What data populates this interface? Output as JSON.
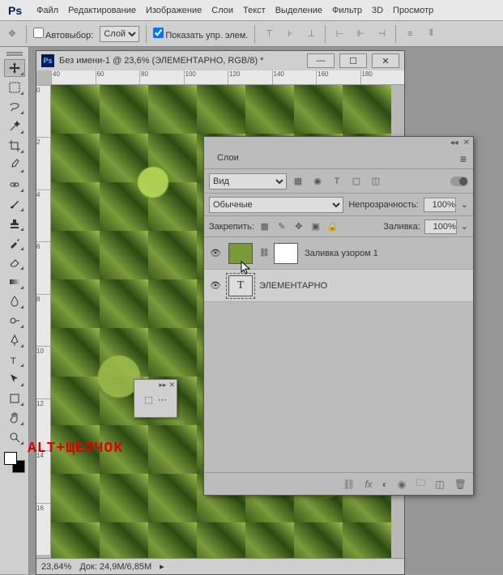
{
  "menu": {
    "logo": "Ps",
    "items": [
      "Файл",
      "Редактирование",
      "Изображение",
      "Слои",
      "Текст",
      "Выделение",
      "Фильтр",
      "3D",
      "Просмотр"
    ]
  },
  "optbar": {
    "autoselect": "Автовыбор:",
    "layer_select": "Слой",
    "show_controls": "Показать упр. элем."
  },
  "doc": {
    "title": "Без имени-1 @ 23,6% (ЭЛЕМЕНТАРНО, RGB/8) *",
    "zoom": "23,64%",
    "docinfo": "Док: 24,9M/6,85M"
  },
  "ruler_h": [
    "40",
    "60",
    "80",
    "100",
    "120",
    "140",
    "160",
    "180"
  ],
  "ruler_v": [
    "0",
    "2",
    "4",
    "6",
    "8",
    "10",
    "12",
    "14",
    "16"
  ],
  "overlay": "ALT+ЩЕЛЧОК",
  "layers": {
    "title": "Слои",
    "filter_kind": "Вид",
    "blend": "Обычные",
    "opacity_label": "Непрозрачность:",
    "opacity": "100%",
    "lock_label": "Закрепить:",
    "fill_label": "Заливка:",
    "fill": "100%",
    "items": [
      {
        "name": "Заливка узором 1"
      },
      {
        "name": "ЭЛЕМЕНТАРНО"
      }
    ]
  }
}
